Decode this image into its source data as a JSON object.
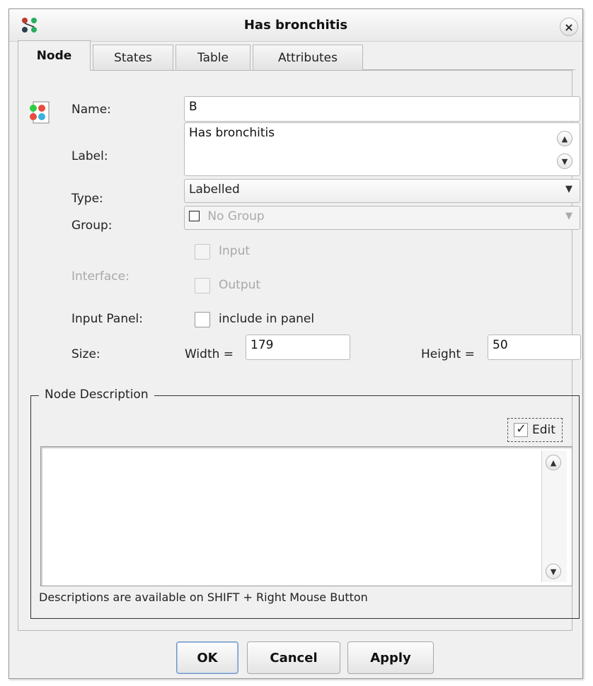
{
  "window": {
    "title": "Has bronchitis",
    "close_label": "×"
  },
  "tabs": [
    {
      "label": "Node",
      "active": true
    },
    {
      "label": "States",
      "active": false
    },
    {
      "label": "Table",
      "active": false
    },
    {
      "label": "Attributes",
      "active": false
    }
  ],
  "form": {
    "name_label": "Name:",
    "name_value": "B",
    "label_label": "Label:",
    "label_value": "Has bronchitis",
    "type_label": "Type:",
    "type_value": "Labelled",
    "group_label": "Group:",
    "group_value": "No Group",
    "interface_label": "Interface:",
    "interface_input_label": "Input",
    "interface_output_label": "Output",
    "input_panel_label": "Input Panel:",
    "include_in_panel_label": "include in panel",
    "size_label": "Size:",
    "width_label": "Width =",
    "width_value": "179",
    "height_label": "Height =",
    "height_value": "50"
  },
  "description": {
    "group_title": "Node Description",
    "edit_label": "Edit",
    "edit_checked": true,
    "text": "",
    "hint": "Descriptions are available on SHIFT + Right Mouse Button"
  },
  "buttons": {
    "ok": "OK",
    "cancel": "Cancel",
    "apply": "Apply"
  },
  "icons": {
    "app": "network-nodes-icon",
    "node": "node-type-icon"
  }
}
